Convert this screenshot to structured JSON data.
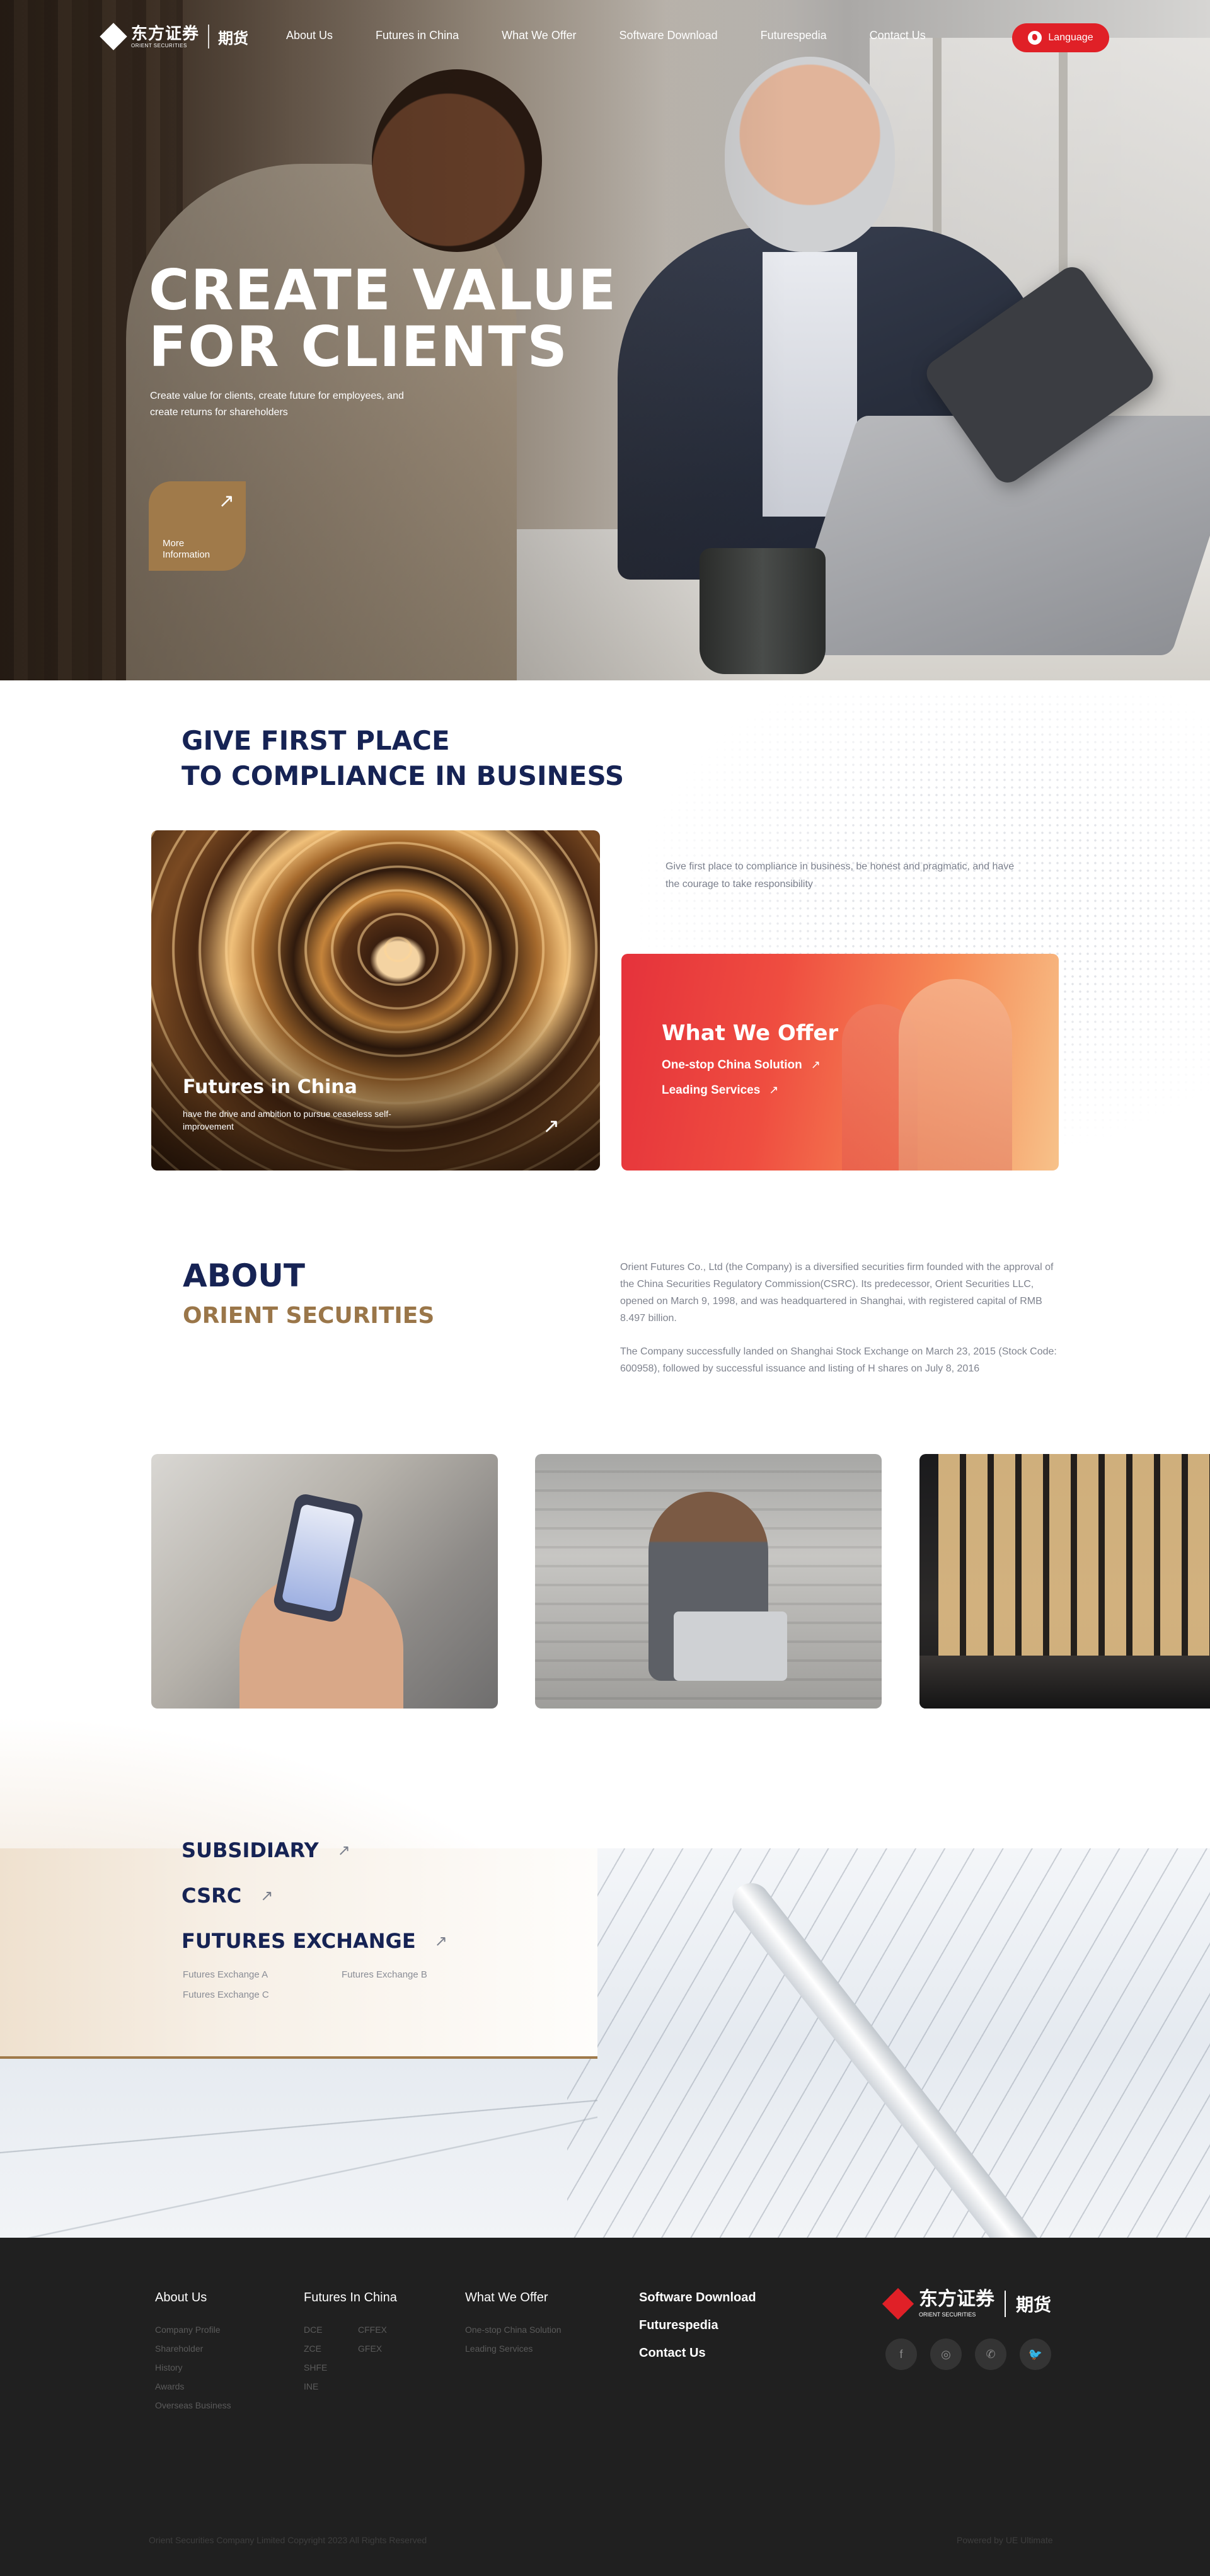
{
  "nav": {
    "logo_cn": "东方证券",
    "logo_en": "ORIENT SECURITIES",
    "logo_sub": "期货",
    "items": [
      "About Us",
      "Futures in China",
      "What We Offer",
      "Software Download",
      "Futurespedia",
      "Contact Us"
    ],
    "language": "Language"
  },
  "hero": {
    "title_line1": "CREATE VALUE",
    "title_line2": "FOR CLIENTS",
    "subtitle": "Create value for clients, create future for employees, and create returns for shareholders",
    "more_label": "More Information"
  },
  "compliance": {
    "title_line1": "GIVE FIRST PLACE",
    "title_line2": "TO COMPLIANCE IN BUSINESS",
    "description": "Give first place to compliance in business, be honest and pragmatic, and have the courage to take responsibility",
    "futures_card": {
      "title": "Futures in China",
      "text": "have the drive and ambition to pursue ceaseless self-improvement"
    },
    "offer_card": {
      "title": "What We Offer",
      "links": [
        "One-stop China Solution",
        "Leading Services"
      ]
    }
  },
  "about": {
    "title": "ABOUT",
    "subtitle": "ORIENT SECURITIES",
    "paragraph1": "Orient Futures Co., Ltd (the Company) is a diversified securities firm founded with the approval of the China Securities Regulatory Commission(CSRC). Its predecessor, Orient Securities LLC, opened on March 9, 1998, and was headquartered in Shanghai, with registered capital of RMB 8.497 billion.",
    "paragraph2": "The Company successfully landed on Shanghai Stock Exchange on March 23, 2015 (Stock Code: 600958), followed by successful issuance and listing of H shares on July 8, 2016"
  },
  "links": {
    "subsidiary": "SUBSIDIARY",
    "csrc": "CSRC",
    "futures_exchange": "FUTURES EXCHANGE",
    "exchanges": [
      "Futures Exchange A",
      "Futures Exchange B",
      "Futures Exchange C"
    ]
  },
  "footer": {
    "col_about": {
      "head": "About Us",
      "items": [
        "Company Profile",
        "Shareholder",
        "History",
        "Awards",
        "Overseas Business"
      ]
    },
    "col_futures": {
      "head": "Futures In China",
      "items_a": [
        "DCE",
        "ZCE",
        "SHFE",
        "INE"
      ],
      "items_b": [
        "CFFEX",
        "GFEX"
      ]
    },
    "col_offer": {
      "head": "What We Offer",
      "items": [
        "One-stop China Solution",
        "Leading Services"
      ]
    },
    "big_links": [
      "Software Download",
      "Futurespedia",
      "Contact Us"
    ],
    "logo_cn": "东方证券",
    "logo_en": "ORIENT SECURITIES",
    "logo_sub": "期货",
    "social": [
      "f",
      "◎",
      "✆",
      "🐦"
    ],
    "copyright": "Orient Securities Company Limited Copyright 2023 All Rights Reserved",
    "powered": "Powered by UE Ultimate"
  },
  "colors": {
    "brand_red": "#e02027",
    "gold": "#a07a4a",
    "navy": "#162354",
    "footer_bg": "#202020"
  }
}
